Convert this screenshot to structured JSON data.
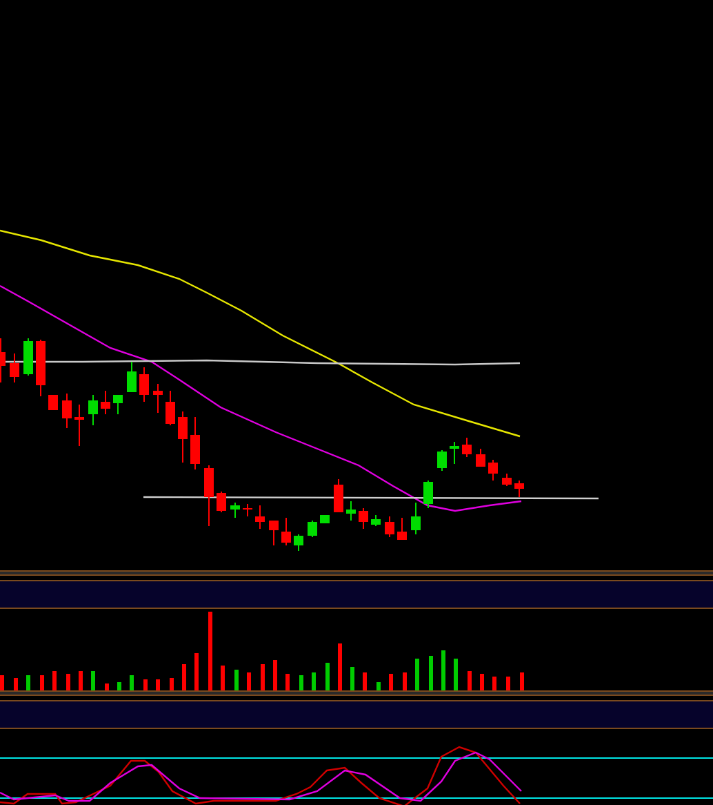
{
  "panels": [
    {
      "kind": "price"
    },
    {
      "kind": "volume"
    },
    {
      "kind": "oscillator"
    }
  ]
}
